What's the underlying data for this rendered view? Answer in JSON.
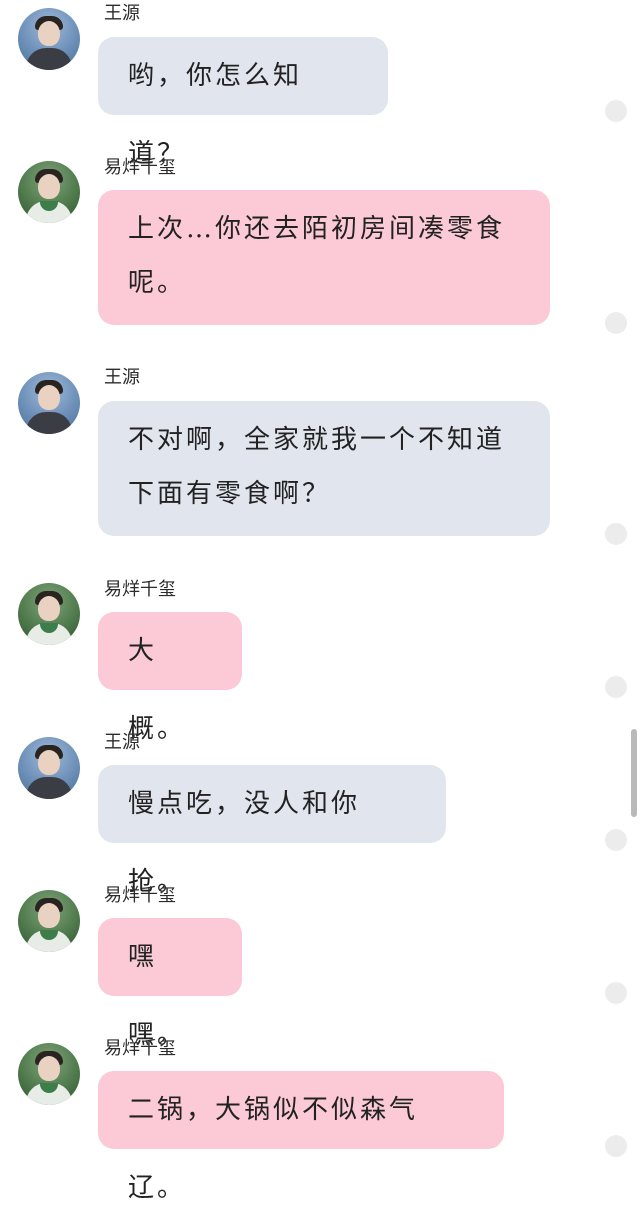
{
  "users": {
    "wang": "王源",
    "yi": "易烊千玺"
  },
  "messages": [
    {
      "sender": "王源",
      "text": "哟，你怎么知道？"
    },
    {
      "sender": "易烊千玺",
      "text": "上次…你还去陌初房间凑零食呢。"
    },
    {
      "sender": "王源",
      "text": "不对啊，全家就我一个不知道下面有零食啊？"
    },
    {
      "sender": "易烊千玺",
      "text": "大概。"
    },
    {
      "sender": "王源",
      "text": "慢点吃，没人和你抢。"
    },
    {
      "sender": "易烊千玺",
      "text": "嘿嘿。"
    },
    {
      "sender": "易烊千玺",
      "text": "二锅，大锅似不似森气辽。"
    }
  ],
  "colors": {
    "wang_bubble": "#e1e5ee",
    "yi_bubble": "#fbcad6",
    "background": "#ffffff",
    "indicator_dot": "#ececec",
    "scrollbar": "#b9b9b9"
  },
  "icons": {
    "wang_avatar": "avatar-wang-yuan",
    "yi_avatar": "avatar-yi-yang-qian-xi",
    "indicator": "circle-dot-icon"
  }
}
